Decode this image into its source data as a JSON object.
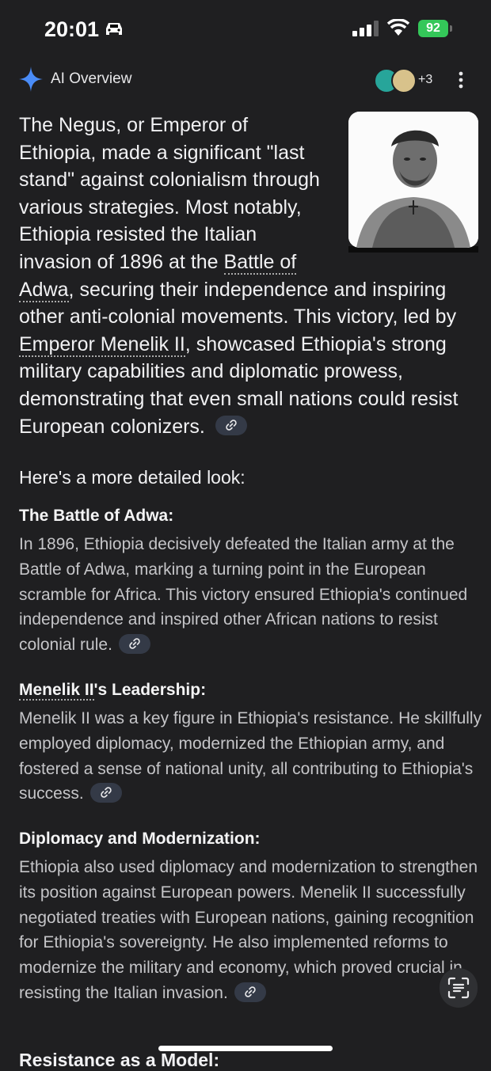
{
  "status_bar": {
    "time": "20:01",
    "battery": "92"
  },
  "ai_overview": {
    "title": "AI Overview",
    "sources_more": "+3"
  },
  "summary": {
    "part1": "The Negus, or Emperor of Ethiopia, made a significant \"last stand\" against colonialism through various strategies. Most notably, Ethiopia resisted the Italian invasion of 1896 at the ",
    "link1": "Battle of Adwa",
    "part2": ", securing their independence and inspiring other anti-colonial movements. This victory, led by ",
    "link2": "Emperor Menelik II",
    "part3": ", showcased Ethiopia's strong military capabilities and diplomatic prowess, demonstrating that even small nations could resist European colonizers."
  },
  "detail_heading": "Here's a more detailed look:",
  "sections": [
    {
      "title": "The Battle of Adwa:",
      "body": "In 1896, Ethiopia decisively defeated the Italian army at the Battle of Adwa, marking a turning point in the European scramble for Africa. This victory ensured Ethiopia's continued independence and inspired other African nations to resist colonial rule."
    },
    {
      "title_link": "Menelik II",
      "title_rest": "'s Leadership:",
      "body": "Menelik II was a key figure in Ethiopia's resistance. He skillfully employed diplomacy, modernized the Ethiopian army, and fostered a sense of national unity, all contributing to Ethiopia's success."
    },
    {
      "title": "Diplomacy and Modernization:",
      "body": "Ethiopia also used diplomacy and modernization to strengthen its position against European powers. Menelik II successfully negotiated treaties with European nations, gaining recognition for Ethiopia's sovereignty. He also implemented reforms to modernize the military and economy, which proved crucial in resisting the Italian invasion."
    }
  ],
  "next_heading": "Resistance as a Model:",
  "colors": {
    "background": "#1f1f21",
    "chip": "#343a47",
    "battery": "#34c759",
    "sparkle": "#4a8cf7"
  }
}
